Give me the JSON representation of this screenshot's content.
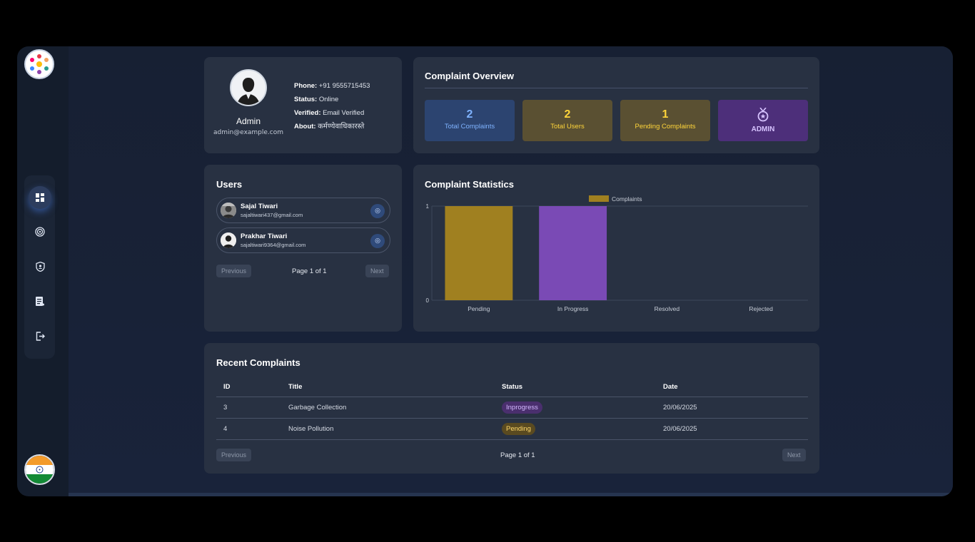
{
  "sidebar": {
    "logo_icon": "community-logo-icon",
    "items": [
      {
        "icon": "dashboard-icon",
        "glyph": "▦",
        "active": true
      },
      {
        "icon": "fingerprint-icon",
        "glyph": "◎"
      },
      {
        "icon": "shield-user-icon",
        "glyph": "⛨"
      },
      {
        "icon": "report-icon",
        "glyph": "▤"
      },
      {
        "icon": "logout-icon",
        "glyph": "⇥"
      }
    ],
    "flag_icon": "india-flag-icon"
  },
  "profile": {
    "name": "Admin",
    "email": "admin@example.com",
    "phone_label": "Phone:",
    "phone": "+91 9555715453",
    "status_label": "Status:",
    "status": "Online",
    "verified_label": "Verified:",
    "verified": "Email Verified",
    "about_label": "About:",
    "about": "कर्मण्येवाधिकारस्ते"
  },
  "overview": {
    "title": "Complaint Overview",
    "stats": [
      {
        "value": "2",
        "label": "Total Complaints",
        "bg": "#2c4470",
        "color": "#7fb3ff"
      },
      {
        "value": "2",
        "label": "Total Users",
        "bg": "#5a5032",
        "color": "#ffd53a"
      },
      {
        "value": "1",
        "label": "Pending Complaints",
        "bg": "#5a5032",
        "color": "#ffd53a"
      },
      {
        "value": "",
        "label": "ADMIN",
        "bg": "#4d2f7a",
        "color": "#d7c3ff",
        "icon": "medal-icon"
      }
    ]
  },
  "users": {
    "title": "Users",
    "list": [
      {
        "name": "Sajal Tiwari",
        "email": "sajaltiwari437@gmail.com"
      },
      {
        "name": "Prakhar Tiwari",
        "email": "sajaltiwari9364@gmail.com"
      }
    ],
    "prev": "Previous",
    "page": "Page 1 of 1",
    "next": "Next"
  },
  "stats": {
    "title": "Complaint Statistics"
  },
  "chart_data": {
    "type": "bar",
    "categories": [
      "Pending",
      "In Progress",
      "Resolved",
      "Rejected"
    ],
    "series": [
      {
        "name": "Complaints",
        "values": [
          1,
          1,
          0,
          0
        ]
      }
    ],
    "colors": [
      "#a08020",
      "#7a4ab5",
      "#3a7acb",
      "#c04040"
    ],
    "legend_color": "#a08020",
    "yticks": [
      "0",
      "1"
    ],
    "ylim": [
      0,
      1
    ],
    "legend": "top-center",
    "grid": true
  },
  "recent": {
    "title": "Recent Complaints",
    "headers": [
      "ID",
      "Title",
      "Status",
      "Date"
    ],
    "rows": [
      {
        "id": "3",
        "title": "Garbage Collection",
        "status": "Inprogress",
        "date": "20/06/2025"
      },
      {
        "id": "4",
        "title": "Noise Pollution",
        "status": "Pending",
        "date": "20/06/2025"
      }
    ],
    "prev": "Previous",
    "page": "Page 1 of 1",
    "next": "Next"
  }
}
